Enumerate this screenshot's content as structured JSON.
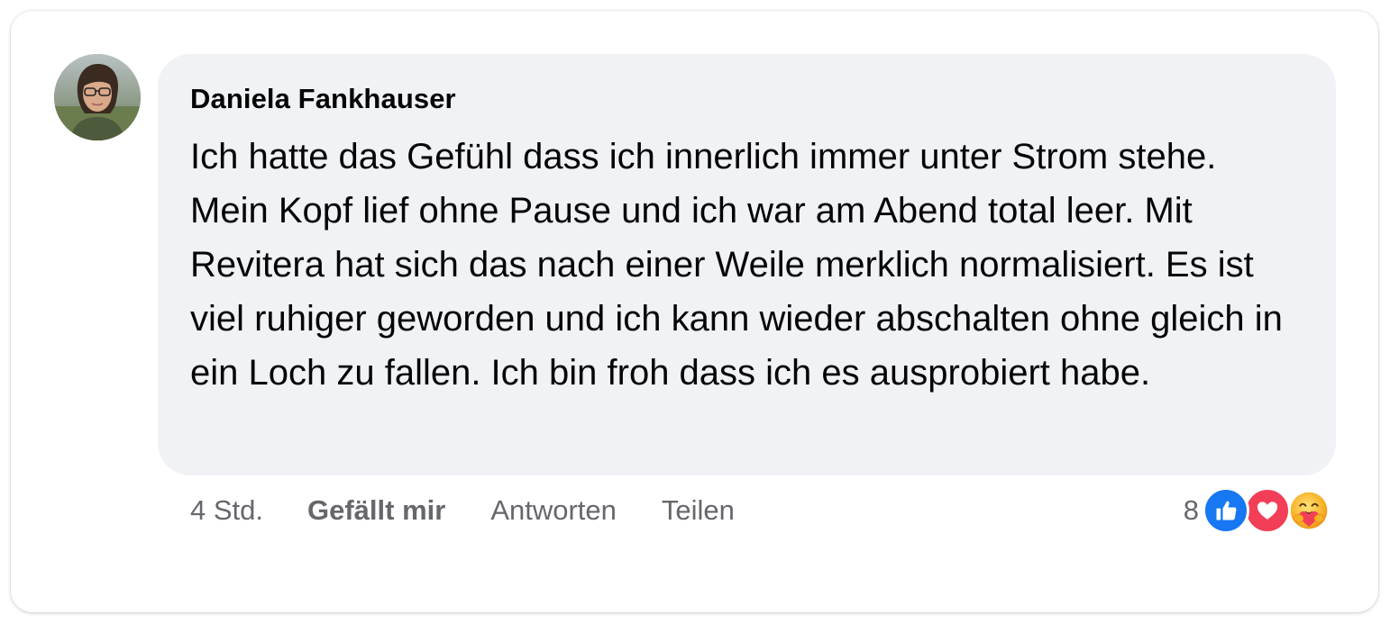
{
  "comment": {
    "author": "Daniela Fankhauser",
    "text": "Ich hatte das Gefühl dass ich innerlich immer unter Strom stehe. Mein Kopf lief ohne Pause und ich war am Abend total leer. Mit Revitera hat sich das nach einer Weile merklich normalisiert. Es ist viel ruhiger geworden und ich kann wieder abschalten ohne gleich in ein Loch zu fallen. Ich bin froh dass ich es ausprobiert habe.",
    "timestamp": "4 Std.",
    "reaction_count": "8"
  },
  "actions": {
    "like_label": "Gefällt mir",
    "reply_label": "Antworten",
    "share_label": "Teilen"
  },
  "reactions": [
    {
      "icon": "like-icon",
      "color": "#1877f2"
    },
    {
      "icon": "love-icon",
      "color": "#f33e58"
    },
    {
      "icon": "care-icon",
      "color": "#f7b125"
    }
  ],
  "colors": {
    "bubble": "#f0f2f5",
    "secondary_text": "#65676b",
    "primary_text": "#050505"
  }
}
